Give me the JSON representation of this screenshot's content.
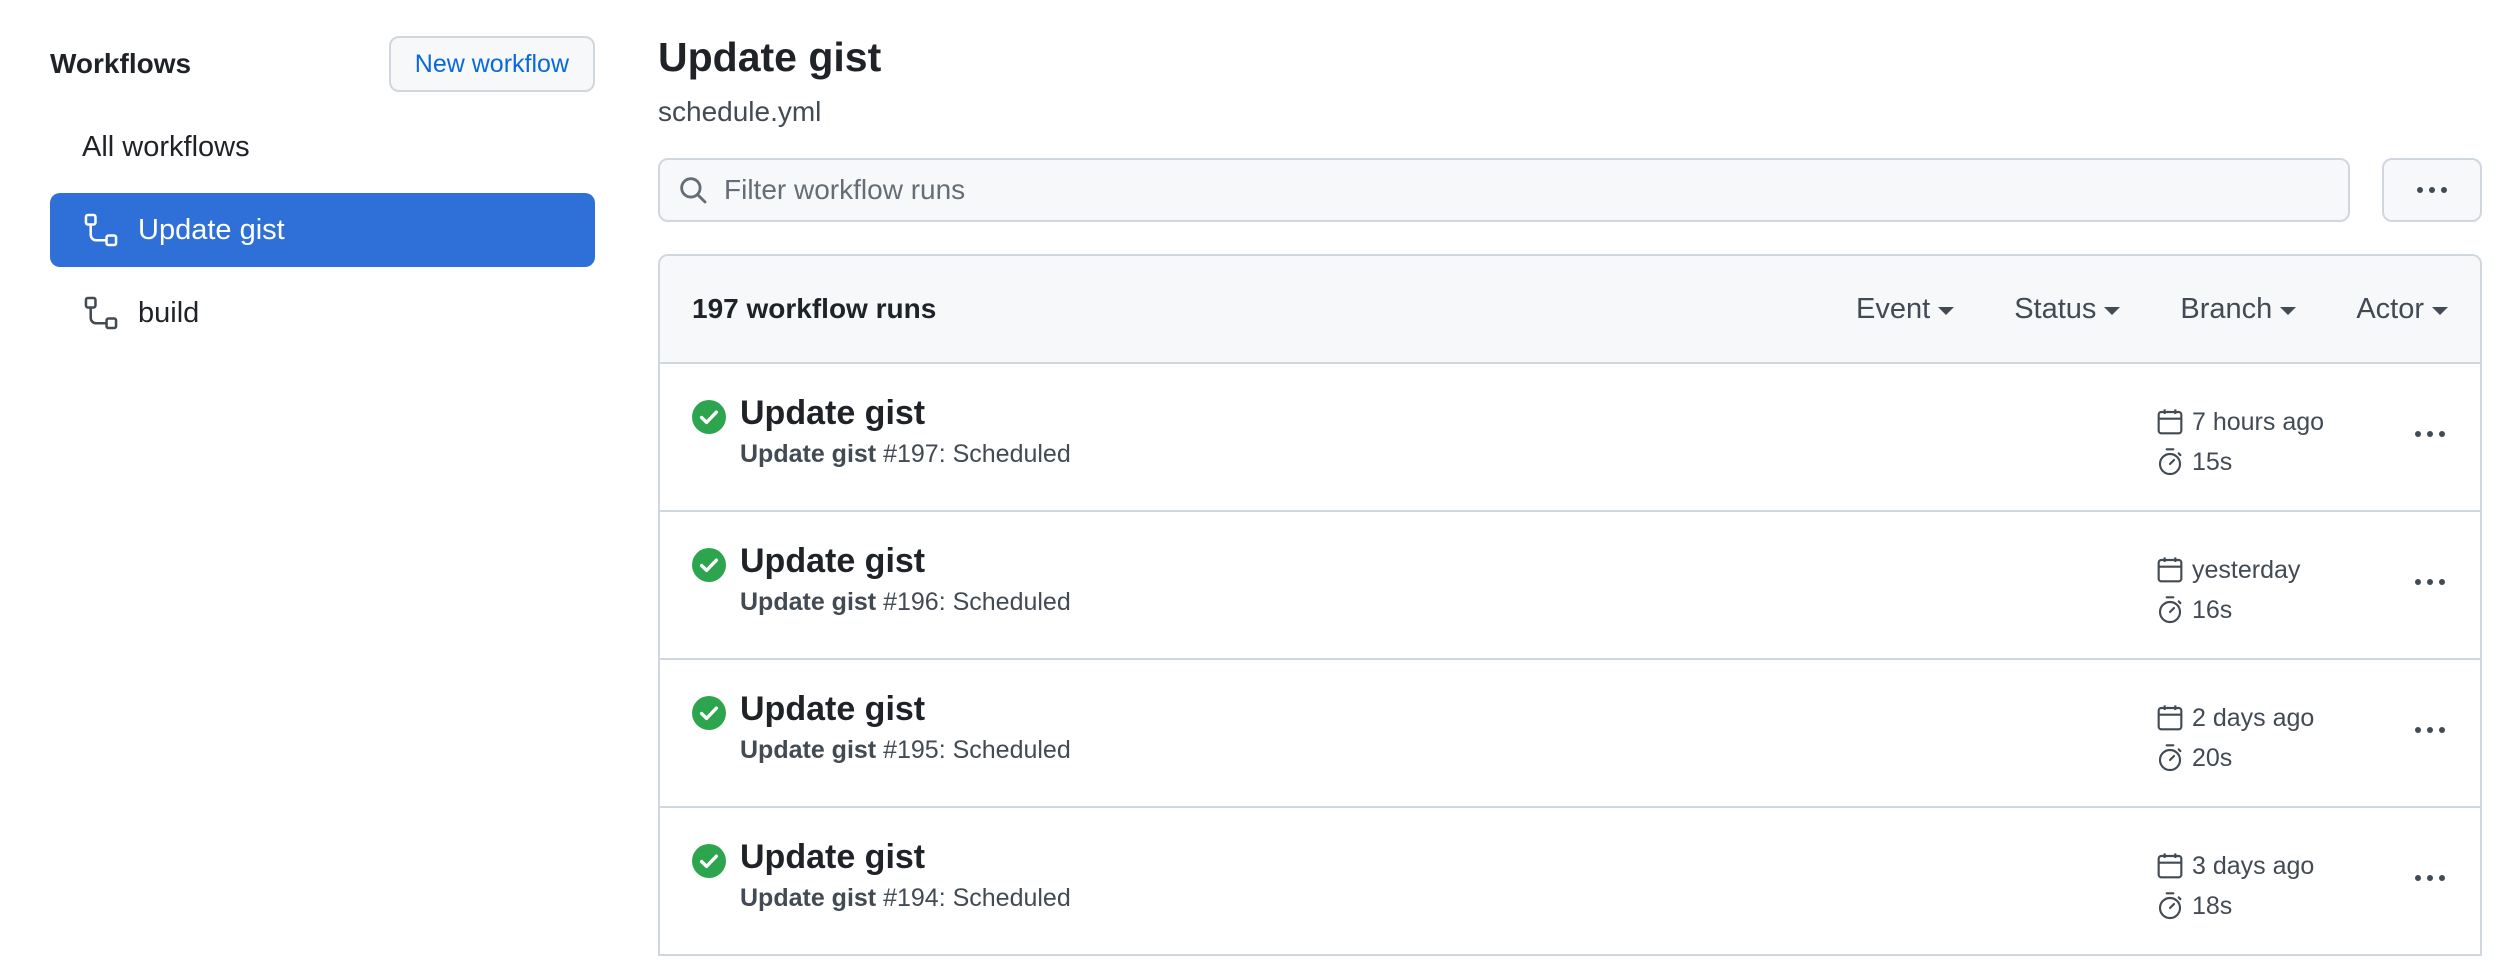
{
  "sidebar": {
    "title": "Workflows",
    "new_workflow_label": "New workflow",
    "items": [
      {
        "label": "All workflows",
        "icon": "none",
        "active": false
      },
      {
        "label": "Update gist",
        "icon": "workflow-icon",
        "active": true
      },
      {
        "label": "build",
        "icon": "workflow-icon",
        "active": false
      }
    ]
  },
  "main": {
    "title": "Update gist",
    "subtitle": "schedule.yml",
    "search": {
      "placeholder": "Filter workflow runs",
      "value": ""
    },
    "runs_count": "197 workflow runs",
    "filters": [
      {
        "label": "Event"
      },
      {
        "label": "Status"
      },
      {
        "label": "Branch"
      },
      {
        "label": "Actor"
      }
    ],
    "runs": [
      {
        "title": "Update gist",
        "workflow": "Update gist",
        "detail": "#197: Scheduled",
        "time": "7 hours ago",
        "duration": "15s",
        "status": "success"
      },
      {
        "title": "Update gist",
        "workflow": "Update gist",
        "detail": "#196: Scheduled",
        "time": "yesterday",
        "duration": "16s",
        "status": "success"
      },
      {
        "title": "Update gist",
        "workflow": "Update gist",
        "detail": "#195: Scheduled",
        "time": "2 days ago",
        "duration": "20s",
        "status": "success"
      },
      {
        "title": "Update gist",
        "workflow": "Update gist",
        "detail": "#194: Scheduled",
        "time": "3 days ago",
        "duration": "18s",
        "status": "success"
      }
    ]
  },
  "colors": {
    "accent": "#2e6fd8",
    "link": "#0969da",
    "success": "#2da44e",
    "border": "#d0d7de",
    "muted": "#656d76"
  }
}
